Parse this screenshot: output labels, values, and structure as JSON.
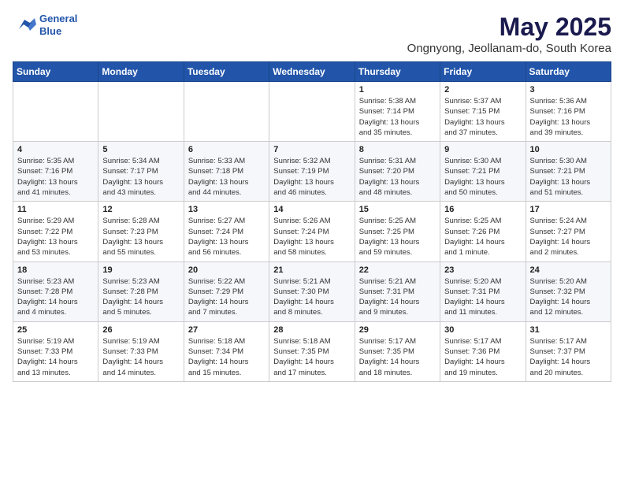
{
  "header": {
    "logo_line1": "General",
    "logo_line2": "Blue",
    "month_title": "May 2025",
    "location": "Ongnyong, Jeollanam-do, South Korea"
  },
  "weekdays": [
    "Sunday",
    "Monday",
    "Tuesday",
    "Wednesday",
    "Thursday",
    "Friday",
    "Saturday"
  ],
  "weeks": [
    [
      {
        "day": "",
        "info": ""
      },
      {
        "day": "",
        "info": ""
      },
      {
        "day": "",
        "info": ""
      },
      {
        "day": "",
        "info": ""
      },
      {
        "day": "1",
        "info": "Sunrise: 5:38 AM\nSunset: 7:14 PM\nDaylight: 13 hours\nand 35 minutes."
      },
      {
        "day": "2",
        "info": "Sunrise: 5:37 AM\nSunset: 7:15 PM\nDaylight: 13 hours\nand 37 minutes."
      },
      {
        "day": "3",
        "info": "Sunrise: 5:36 AM\nSunset: 7:16 PM\nDaylight: 13 hours\nand 39 minutes."
      }
    ],
    [
      {
        "day": "4",
        "info": "Sunrise: 5:35 AM\nSunset: 7:16 PM\nDaylight: 13 hours\nand 41 minutes."
      },
      {
        "day": "5",
        "info": "Sunrise: 5:34 AM\nSunset: 7:17 PM\nDaylight: 13 hours\nand 43 minutes."
      },
      {
        "day": "6",
        "info": "Sunrise: 5:33 AM\nSunset: 7:18 PM\nDaylight: 13 hours\nand 44 minutes."
      },
      {
        "day": "7",
        "info": "Sunrise: 5:32 AM\nSunset: 7:19 PM\nDaylight: 13 hours\nand 46 minutes."
      },
      {
        "day": "8",
        "info": "Sunrise: 5:31 AM\nSunset: 7:20 PM\nDaylight: 13 hours\nand 48 minutes."
      },
      {
        "day": "9",
        "info": "Sunrise: 5:30 AM\nSunset: 7:21 PM\nDaylight: 13 hours\nand 50 minutes."
      },
      {
        "day": "10",
        "info": "Sunrise: 5:30 AM\nSunset: 7:21 PM\nDaylight: 13 hours\nand 51 minutes."
      }
    ],
    [
      {
        "day": "11",
        "info": "Sunrise: 5:29 AM\nSunset: 7:22 PM\nDaylight: 13 hours\nand 53 minutes."
      },
      {
        "day": "12",
        "info": "Sunrise: 5:28 AM\nSunset: 7:23 PM\nDaylight: 13 hours\nand 55 minutes."
      },
      {
        "day": "13",
        "info": "Sunrise: 5:27 AM\nSunset: 7:24 PM\nDaylight: 13 hours\nand 56 minutes."
      },
      {
        "day": "14",
        "info": "Sunrise: 5:26 AM\nSunset: 7:24 PM\nDaylight: 13 hours\nand 58 minutes."
      },
      {
        "day": "15",
        "info": "Sunrise: 5:25 AM\nSunset: 7:25 PM\nDaylight: 13 hours\nand 59 minutes."
      },
      {
        "day": "16",
        "info": "Sunrise: 5:25 AM\nSunset: 7:26 PM\nDaylight: 14 hours\nand 1 minute."
      },
      {
        "day": "17",
        "info": "Sunrise: 5:24 AM\nSunset: 7:27 PM\nDaylight: 14 hours\nand 2 minutes."
      }
    ],
    [
      {
        "day": "18",
        "info": "Sunrise: 5:23 AM\nSunset: 7:28 PM\nDaylight: 14 hours\nand 4 minutes."
      },
      {
        "day": "19",
        "info": "Sunrise: 5:23 AM\nSunset: 7:28 PM\nDaylight: 14 hours\nand 5 minutes."
      },
      {
        "day": "20",
        "info": "Sunrise: 5:22 AM\nSunset: 7:29 PM\nDaylight: 14 hours\nand 7 minutes."
      },
      {
        "day": "21",
        "info": "Sunrise: 5:21 AM\nSunset: 7:30 PM\nDaylight: 14 hours\nand 8 minutes."
      },
      {
        "day": "22",
        "info": "Sunrise: 5:21 AM\nSunset: 7:31 PM\nDaylight: 14 hours\nand 9 minutes."
      },
      {
        "day": "23",
        "info": "Sunrise: 5:20 AM\nSunset: 7:31 PM\nDaylight: 14 hours\nand 11 minutes."
      },
      {
        "day": "24",
        "info": "Sunrise: 5:20 AM\nSunset: 7:32 PM\nDaylight: 14 hours\nand 12 minutes."
      }
    ],
    [
      {
        "day": "25",
        "info": "Sunrise: 5:19 AM\nSunset: 7:33 PM\nDaylight: 14 hours\nand 13 minutes."
      },
      {
        "day": "26",
        "info": "Sunrise: 5:19 AM\nSunset: 7:33 PM\nDaylight: 14 hours\nand 14 minutes."
      },
      {
        "day": "27",
        "info": "Sunrise: 5:18 AM\nSunset: 7:34 PM\nDaylight: 14 hours\nand 15 minutes."
      },
      {
        "day": "28",
        "info": "Sunrise: 5:18 AM\nSunset: 7:35 PM\nDaylight: 14 hours\nand 17 minutes."
      },
      {
        "day": "29",
        "info": "Sunrise: 5:17 AM\nSunset: 7:35 PM\nDaylight: 14 hours\nand 18 minutes."
      },
      {
        "day": "30",
        "info": "Sunrise: 5:17 AM\nSunset: 7:36 PM\nDaylight: 14 hours\nand 19 minutes."
      },
      {
        "day": "31",
        "info": "Sunrise: 5:17 AM\nSunset: 7:37 PM\nDaylight: 14 hours\nand 20 minutes."
      }
    ]
  ]
}
